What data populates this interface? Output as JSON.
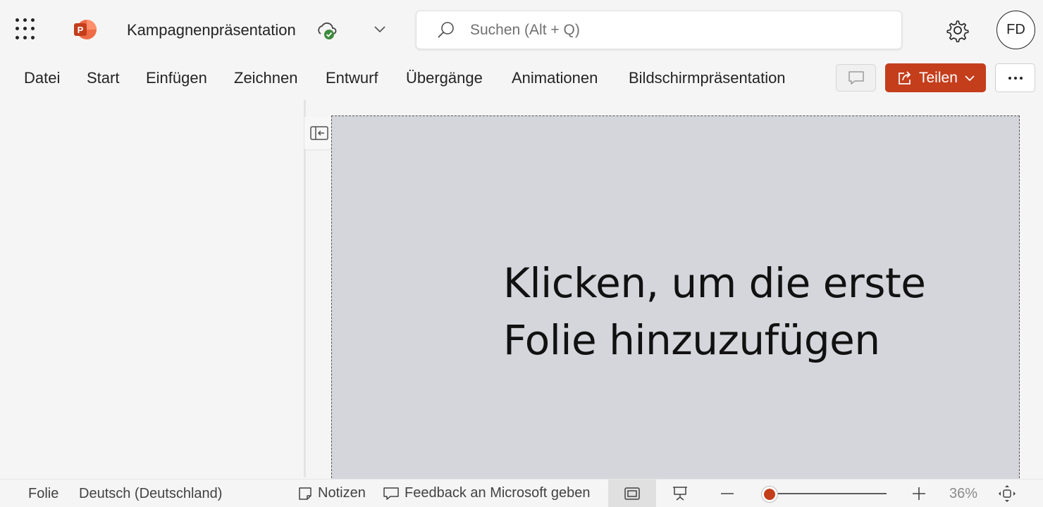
{
  "app": {
    "document_title": "Kampagnenpräsentation",
    "search_placeholder": "Suchen (Alt + Q)",
    "user_initials": "FD",
    "accent_color": "#c43e1c"
  },
  "menu": {
    "items": [
      "Datei",
      "Start",
      "Einfügen",
      "Zeichnen",
      "Entwurf",
      "Übergänge",
      "Animationen",
      "Bildschirmpräsentation"
    ],
    "share_label": "Teilen"
  },
  "slide": {
    "placeholder_line1": "Klicken, um die erste",
    "placeholder_line2": "Folie hinzuzufügen"
  },
  "status": {
    "slide_label": "Folie",
    "language": "Deutsch (Deutschland)",
    "notes_label": "Notizen",
    "feedback_label": "Feedback an Microsoft geben",
    "zoom_text": "36%",
    "zoom_slider_fraction": 0
  },
  "icons": [
    "app-launcher-icon",
    "powerpoint-logo-icon",
    "cloud-saved-icon",
    "chevron-down-icon",
    "search-icon",
    "gear-icon",
    "comment-icon",
    "share-icon",
    "more-icon",
    "collapse-pane-icon",
    "notes-icon",
    "feedback-icon",
    "normal-view-icon",
    "presenter-view-icon",
    "zoom-out-icon",
    "zoom-in-icon",
    "fit-to-window-icon"
  ]
}
